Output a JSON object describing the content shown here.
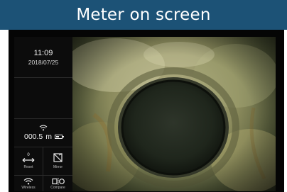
{
  "header": {
    "title": "Meter on screen"
  },
  "status": {
    "time": "11:09",
    "date": "2018/07/25"
  },
  "meter": {
    "distance": "000.5",
    "unit": "m",
    "battery_level": 0.6
  },
  "buttons": {
    "reset": {
      "value": "0",
      "label": "Reset",
      "icon": "reset-arrows-icon"
    },
    "mirror": {
      "label": "Mirror",
      "icon": "mirror-icon"
    },
    "wireless": {
      "label": "Wireless",
      "icon": "wifi-icon"
    },
    "compare": {
      "label": "Compare",
      "icon": "compare-icon"
    }
  },
  "colors": {
    "header_bg": "#1c5276",
    "panel_bg": "#0c0c0c",
    "text": "#e8e8e8"
  }
}
